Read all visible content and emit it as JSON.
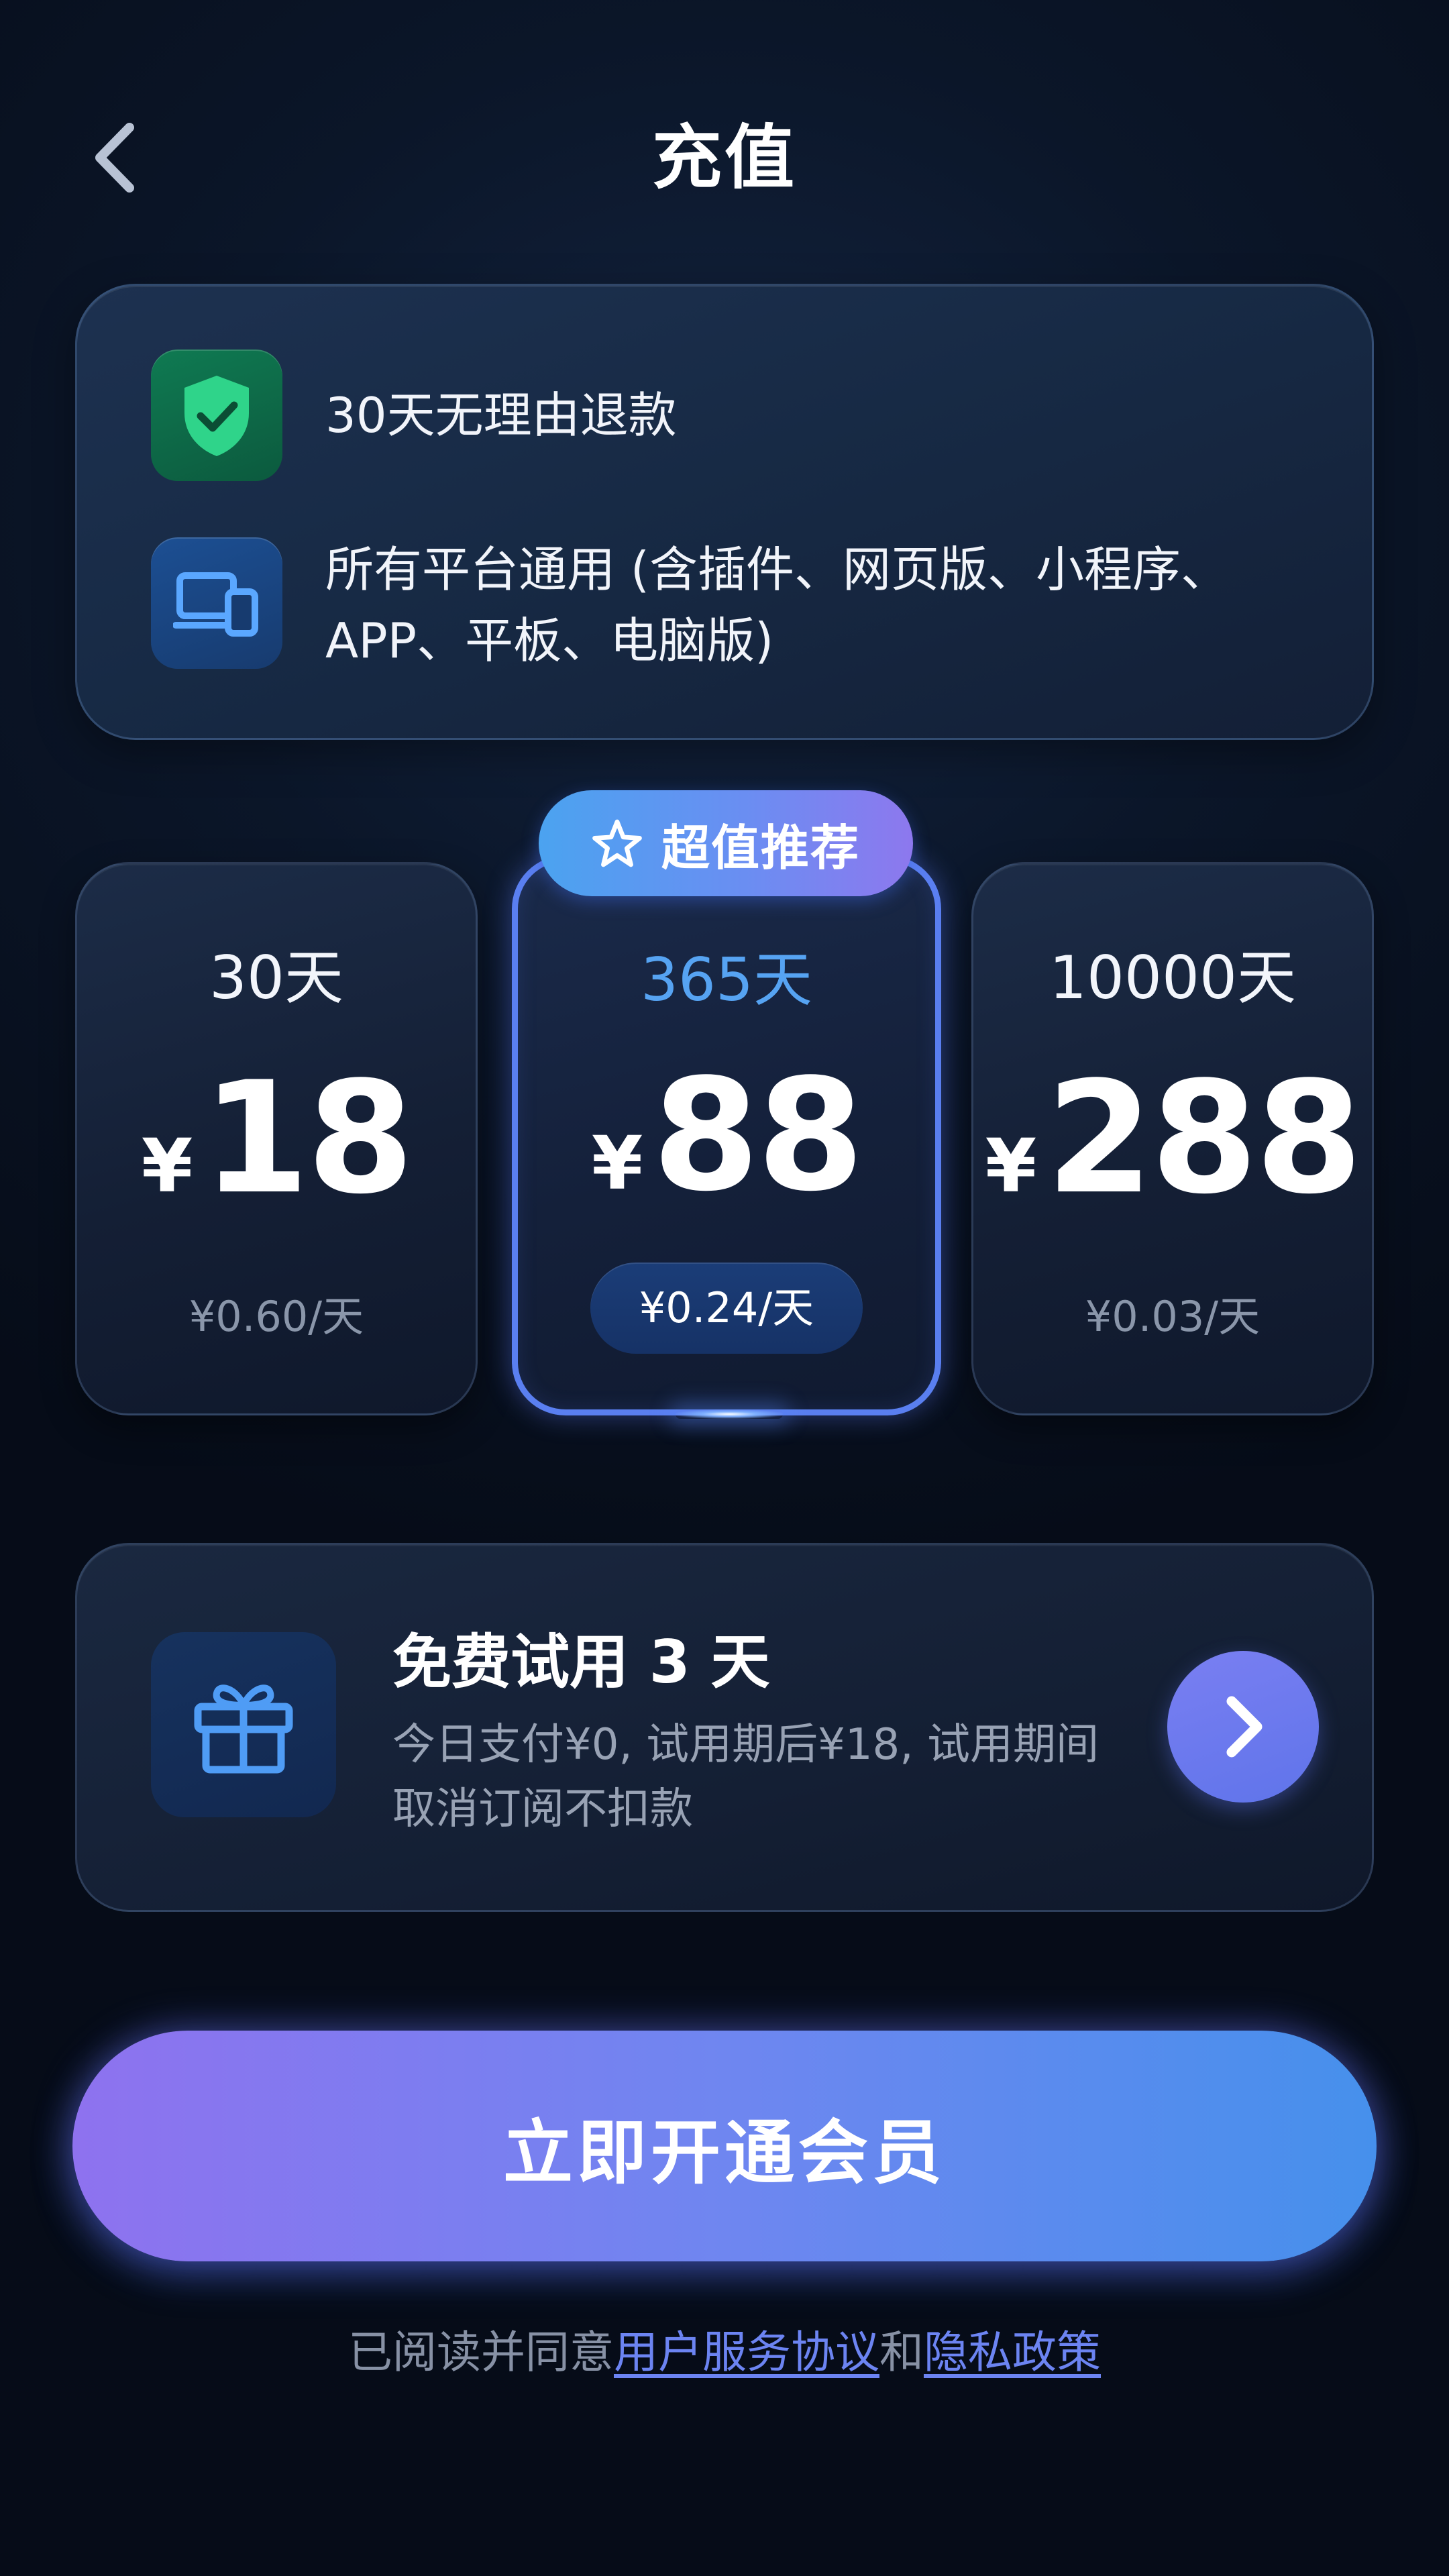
{
  "header": {
    "title": "充值"
  },
  "features": [
    {
      "icon": "shield-check-icon",
      "text": "30天无理由退款"
    },
    {
      "icon": "devices-icon",
      "text": "所有平台通用 (含插件、网页版、小程序、APP、平板、电脑版)"
    }
  ],
  "plans": [
    {
      "days": "30天",
      "currency": "¥",
      "price": "18",
      "per_day": "¥0.60/天",
      "selected": false
    },
    {
      "days": "365天",
      "currency": "¥",
      "price": "88",
      "per_day": "¥0.24/天",
      "selected": true,
      "badge": "超值推荐"
    },
    {
      "days": "10000天",
      "currency": "¥",
      "price": "288",
      "per_day": "¥0.03/天",
      "selected": false
    }
  ],
  "trial": {
    "title": "免费试用 3 天",
    "description": "今日支付¥0, 试用期后¥18, 试用期间取消订阅不扣款"
  },
  "cta": {
    "label": "立即开通会员"
  },
  "agreement": {
    "prefix": "已阅读并同意",
    "terms_link": "用户服务协议",
    "joiner": "和",
    "privacy_link": "隐私政策"
  },
  "colors": {
    "background": "#0b1629",
    "accent_blue": "#56a3f2",
    "accent_purple": "#8e72ef",
    "selected_border": "#5a7ff0",
    "link": "#6c84f2",
    "success_green": "#2fd48a"
  }
}
